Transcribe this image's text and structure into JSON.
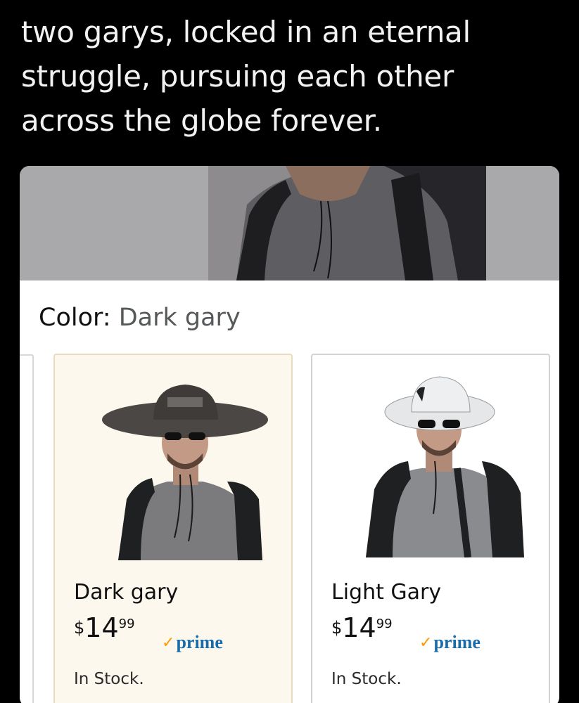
{
  "caption": {
    "line1": "two garys, locked in an eternal",
    "line2": "struggle, pursuing each other",
    "line3": "across the globe forever."
  },
  "colors": {
    "page_bg": "#000000",
    "hero_bg": "#a9a8ab",
    "selected_bg": "#fdf8ee",
    "prime_check": "#ff9900",
    "prime_text": "#1a6ca8"
  },
  "product": {
    "color_label": "Color:",
    "color_value": "Dark gary",
    "swatches": [
      {
        "name": "Dark gary",
        "price_currency": "$",
        "price_whole": "14",
        "price_fraction": "99",
        "prime_check": "✓",
        "prime_word": "prime",
        "stock": "In Stock.",
        "selected": true,
        "hat_color": "#4a4745"
      },
      {
        "name": "Light Gary",
        "price_currency": "$",
        "price_whole": "14",
        "price_fraction": "99",
        "prime_check": "✓",
        "prime_word": "prime",
        "stock": "In Stock.",
        "selected": false,
        "hat_color": "#e6e7e8"
      }
    ]
  }
}
